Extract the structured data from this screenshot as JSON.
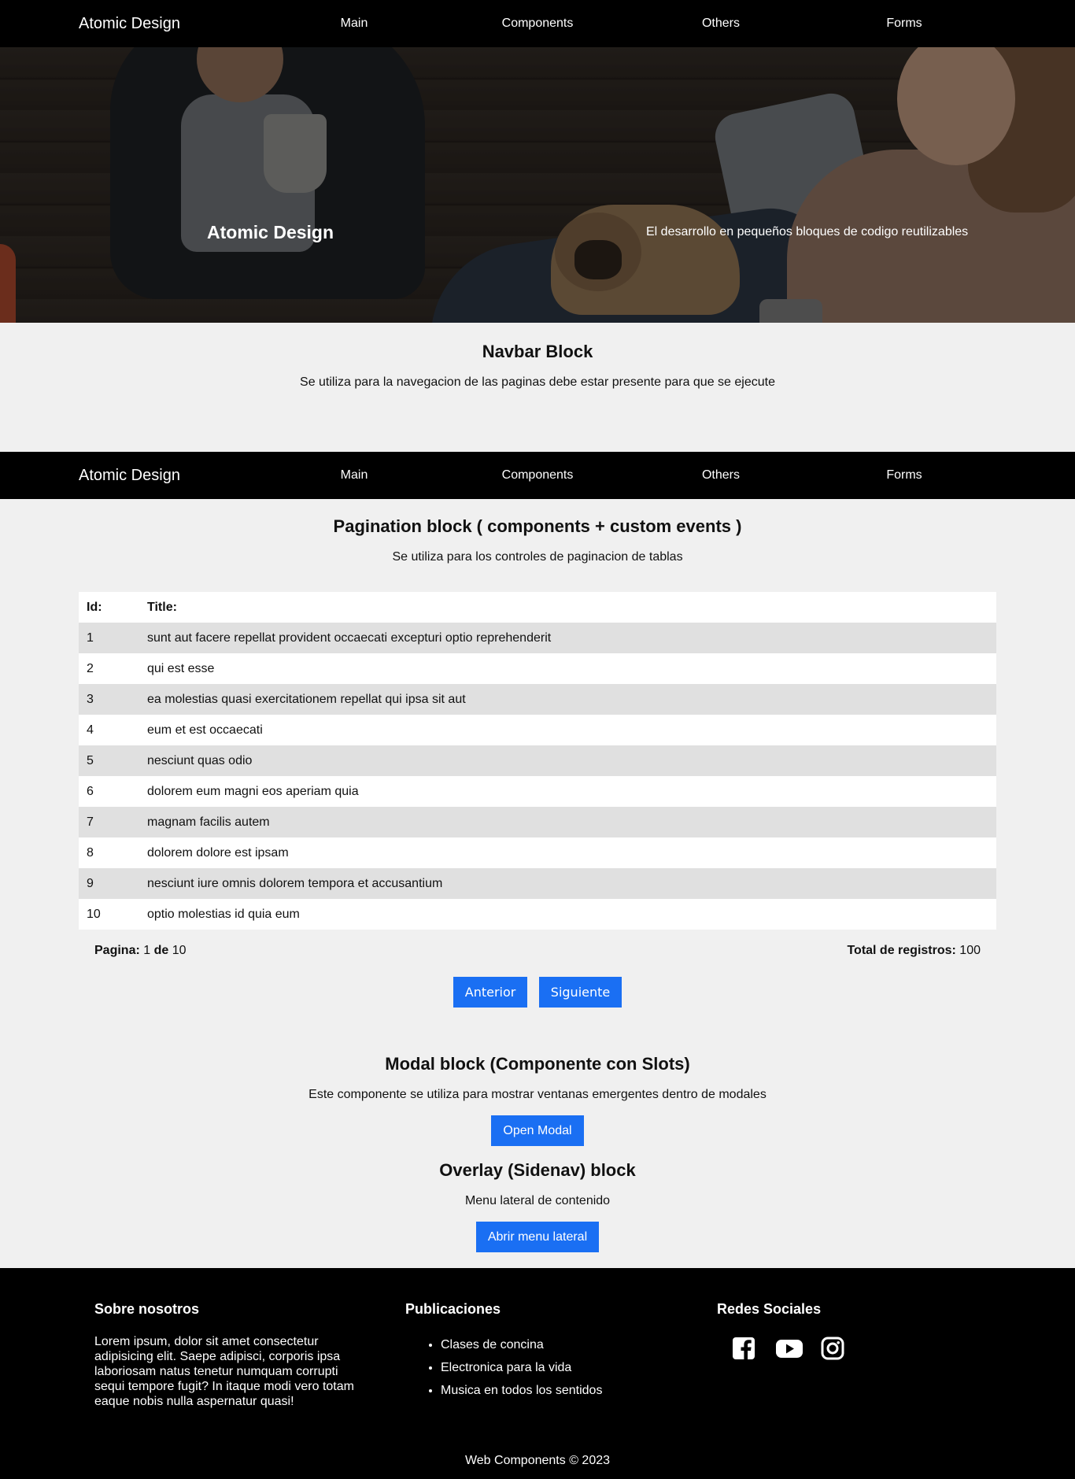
{
  "navbar": {
    "brand": "Atomic Design",
    "links": [
      "Main",
      "Components",
      "Others",
      "Forms"
    ]
  },
  "hero": {
    "title": "Atomic Design",
    "subtitle": "El desarrollo en pequeños bloques de codigo reutilizables"
  },
  "navbar_block": {
    "title": "Navbar Block",
    "description": "Se utiliza para la navegacion de las paginas debe estar presente para que se ejecute"
  },
  "pagination_block": {
    "title": "Pagination block ( components + custom events )",
    "description": "Se utiliza para los controles de paginacion de tablas",
    "table": {
      "headers": [
        "Id:",
        "Title:"
      ],
      "rows": [
        [
          "1",
          "sunt aut facere repellat provident occaecati excepturi optio reprehenderit"
        ],
        [
          "2",
          "qui est esse"
        ],
        [
          "3",
          "ea molestias quasi exercitationem repellat qui ipsa sit aut"
        ],
        [
          "4",
          "eum et est occaecati"
        ],
        [
          "5",
          "nesciunt quas odio"
        ],
        [
          "6",
          "dolorem eum magni eos aperiam quia"
        ],
        [
          "7",
          "magnam facilis autem"
        ],
        [
          "8",
          "dolorem dolore est ipsam"
        ],
        [
          "9",
          "nesciunt iure omnis dolorem tempora et accusantium"
        ],
        [
          "10",
          "optio molestias id quia eum"
        ]
      ]
    },
    "pager": {
      "page_label": "Pagina:",
      "current_page": "1",
      "of_label": "de",
      "total_pages": "10",
      "total_label": "Total de registros:",
      "total_records": "100",
      "prev_label": "Anterior",
      "next_label": "Siguiente"
    }
  },
  "modal_block": {
    "title": "Modal block (Componente con Slots)",
    "description": "Este componente se utiliza para mostrar ventanas emergentes dentro de modales",
    "button_label": "Open Modal"
  },
  "overlay_block": {
    "title": "Overlay (Sidenav) block",
    "description": "Menu lateral de contenido",
    "button_label": "Abrir menu lateral"
  },
  "footer": {
    "about": {
      "title": "Sobre nosotros",
      "text": "Lorem ipsum, dolor sit amet consectetur adipisicing elit. Saepe adipisci, corporis ipsa laboriosam natus tenetur numquam corrupti sequi tempore fugit? In itaque modi vero totam eaque nobis nulla aspernatur quasi!"
    },
    "publications": {
      "title": "Publicaciones",
      "items": [
        "Clases de concina",
        "Electronica para la vida",
        "Musica en todos los sentidos"
      ]
    },
    "social": {
      "title": "Redes Sociales",
      "icons": [
        "facebook-icon",
        "youtube-icon",
        "instagram-icon"
      ]
    },
    "copyright": "Web Components © 2023"
  },
  "colors": {
    "accent": "#1a6ff3",
    "navbar_bg": "#000000",
    "page_bg": "#f0f0f0",
    "row_alt": "#e0e0e0"
  }
}
